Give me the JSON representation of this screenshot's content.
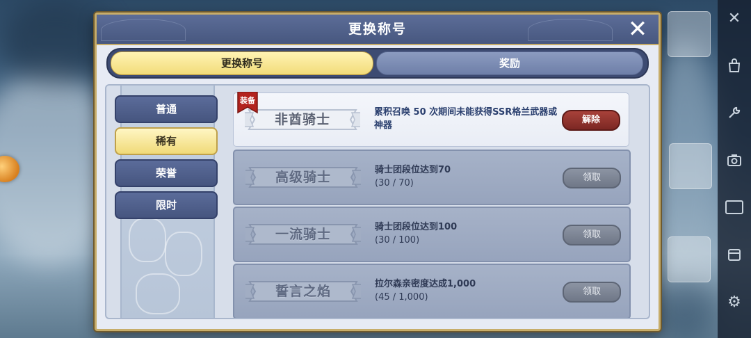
{
  "dialog": {
    "title": "更换称号",
    "close_icon": "close-icon"
  },
  "tabs": [
    {
      "label": "更换称号",
      "active": true
    },
    {
      "label": "奖励",
      "active": false
    }
  ],
  "categories": [
    {
      "label": "普通",
      "selected": false
    },
    {
      "label": "稀有",
      "selected": true
    },
    {
      "label": "荣誉",
      "selected": false
    },
    {
      "label": "限时",
      "selected": false
    }
  ],
  "titles": [
    {
      "name": "非酋骑士",
      "tag": "装备",
      "condition": "累积召唤 50 次期间未能获得SSR格兰武器或神器",
      "progress": "",
      "button": "解除",
      "status": "equipped"
    },
    {
      "name": "高级骑士",
      "tag": "",
      "condition": "骑士团段位达到70",
      "progress": "(30 / 70)",
      "button": "领取",
      "status": "locked"
    },
    {
      "name": "一流骑士",
      "tag": "",
      "condition": "骑士团段位达到100",
      "progress": "(30 / 100)",
      "button": "领取",
      "status": "locked"
    },
    {
      "name": "誓言之焰",
      "tag": "",
      "condition": "拉尔森亲密度达成1,000",
      "progress": "(45 / 1,000)",
      "button": "领取",
      "status": "locked"
    }
  ],
  "side_toolbar": {
    "icons": [
      "close-icon",
      "shop-bag-icon",
      "wrench-icon",
      "camera-icon",
      "video-icon",
      "calendar-icon",
      "gear-icon"
    ]
  },
  "colors": {
    "accent_gold": "#f2dc7a",
    "header_blue": "#47577f",
    "remove_red": "#7c2723"
  }
}
